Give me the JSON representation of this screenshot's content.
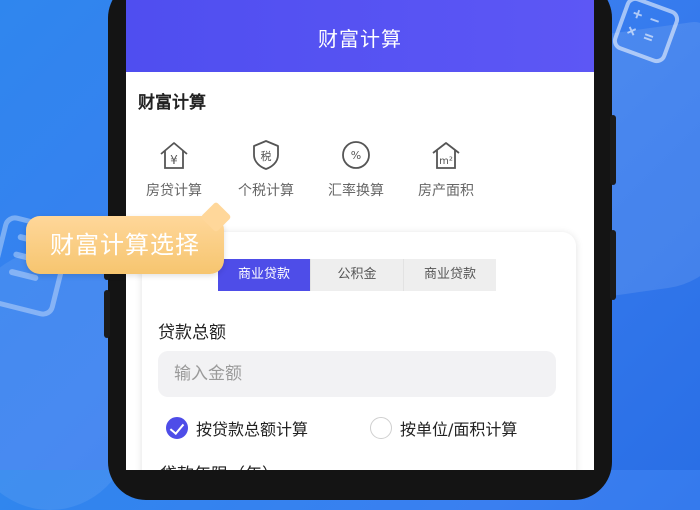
{
  "header": {
    "title": "财富计算"
  },
  "section": {
    "title": "财富计算"
  },
  "categories": [
    {
      "label": "房贷计算",
      "icon": "house-yen-icon"
    },
    {
      "label": "个税计算",
      "icon": "tax-shield-icon"
    },
    {
      "label": "汇率换算",
      "icon": "percent-circle-icon"
    },
    {
      "label": "房产面积",
      "icon": "house-area-icon"
    }
  ],
  "tooltip": {
    "text": "财富计算选择"
  },
  "loan_tabs": [
    {
      "label": "商业贷款",
      "active": true
    },
    {
      "label": "公积金",
      "active": false
    },
    {
      "label": "商业贷款",
      "active": false
    }
  ],
  "form": {
    "amount_label": "贷款总额",
    "amount_placeholder": "输入金额",
    "radio_total": "按贷款总额计算",
    "radio_unit": "按单位/面积计算",
    "term_label": "贷款年限（年）"
  },
  "colors": {
    "primary": "#4e4de8",
    "bubble": "#f6c56f",
    "background": "#2f86ee"
  }
}
